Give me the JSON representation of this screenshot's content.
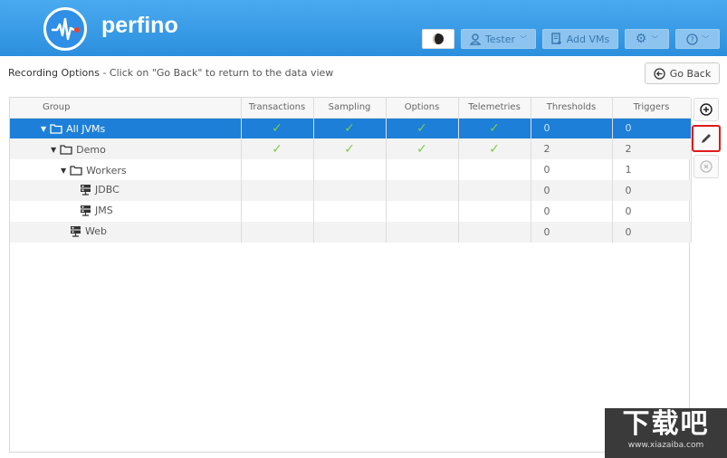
{
  "app": {
    "brand": "perfino",
    "colors": {
      "header": "#2b8fdd",
      "selected_row": "#1d7fd8",
      "check": "#7ccc4a",
      "highlight": "#e01a1a"
    }
  },
  "header": {
    "buttons": [
      {
        "name": "theme-toggle",
        "icon": "half-moon-icon",
        "label": ""
      },
      {
        "name": "user-menu",
        "icon": "user-icon",
        "label": "Tester",
        "dropdown": true
      },
      {
        "name": "add-vms",
        "icon": "add-document-icon",
        "label": "Add VMs"
      },
      {
        "name": "settings-menu",
        "icon": "gear-icon",
        "label": "",
        "dropdown": true
      },
      {
        "name": "help-menu",
        "icon": "help-icon",
        "label": "",
        "dropdown": true
      }
    ]
  },
  "page": {
    "title": "Recording Options",
    "hint": " - Click on \"Go Back\" to return to the data view",
    "go_back_label": "Go Back"
  },
  "table": {
    "columns": [
      "Group",
      "Transactions",
      "Sampling",
      "Options",
      "Telemetries",
      "Thresholds",
      "Triggers"
    ],
    "rows": [
      {
        "name": "All JVMs",
        "type": "folder",
        "level": 0,
        "expanded": true,
        "selected": true,
        "transactions": true,
        "sampling": true,
        "options": true,
        "telemetries": true,
        "thresholds": "0",
        "triggers": "0"
      },
      {
        "name": "Demo",
        "type": "folder",
        "level": 1,
        "expanded": true,
        "selected": false,
        "transactions": true,
        "sampling": true,
        "options": true,
        "telemetries": true,
        "thresholds": "2",
        "triggers": "2"
      },
      {
        "name": "Workers",
        "type": "folder",
        "level": 2,
        "expanded": true,
        "selected": false,
        "transactions": false,
        "sampling": false,
        "options": false,
        "telemetries": false,
        "thresholds": "0",
        "triggers": "1"
      },
      {
        "name": "JDBC",
        "type": "vm",
        "level": 3,
        "selected": false,
        "transactions": false,
        "sampling": false,
        "options": false,
        "telemetries": false,
        "thresholds": "0",
        "triggers": "0"
      },
      {
        "name": "JMS",
        "type": "vm",
        "level": 3,
        "selected": false,
        "transactions": false,
        "sampling": false,
        "options": false,
        "telemetries": false,
        "thresholds": "0",
        "triggers": "0"
      },
      {
        "name": "Web",
        "type": "vm",
        "level": 2,
        "selected": false,
        "transactions": false,
        "sampling": false,
        "options": false,
        "telemetries": false,
        "thresholds": "0",
        "triggers": "0"
      }
    ],
    "check_glyph": "✓"
  },
  "side_actions": [
    {
      "name": "add-button",
      "icon": "plus-circle-icon",
      "highlighted": false,
      "enabled": true
    },
    {
      "name": "edit-button",
      "icon": "pencil-icon",
      "highlighted": true,
      "enabled": true
    },
    {
      "name": "delete-button",
      "icon": "x-circle-icon",
      "highlighted": false,
      "enabled": false
    }
  ],
  "watermark": {
    "big": "下载吧",
    "small": "www.xiazaiba.com"
  }
}
